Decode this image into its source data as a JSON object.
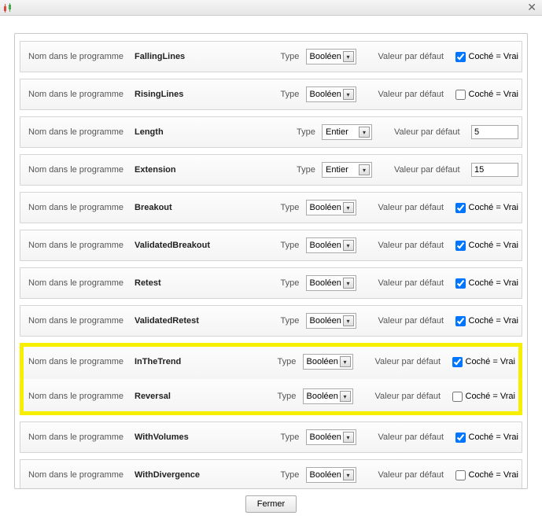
{
  "labels": {
    "name": "Nom dans le programme",
    "type": "Type",
    "default": "Valeur par défaut",
    "checked_true": "Coché = Vrai",
    "close_button": "Fermer"
  },
  "type_options": {
    "boolean": "Booléen",
    "integer": "Entier"
  },
  "rows": [
    {
      "name": "FallingLines",
      "type": "boolean",
      "checked": true
    },
    {
      "name": "RisingLines",
      "type": "boolean",
      "checked": false
    },
    {
      "name": "Length",
      "type": "integer",
      "value": "5"
    },
    {
      "name": "Extension",
      "type": "integer",
      "value": "15"
    },
    {
      "name": "Breakout",
      "type": "boolean",
      "checked": true
    },
    {
      "name": "ValidatedBreakout",
      "type": "boolean",
      "checked": true
    },
    {
      "name": "Retest",
      "type": "boolean",
      "checked": true
    },
    {
      "name": "ValidatedRetest",
      "type": "boolean",
      "checked": true
    },
    {
      "name": "InTheTrend",
      "type": "boolean",
      "checked": true,
      "highlight": "top"
    },
    {
      "name": "Reversal",
      "type": "boolean",
      "checked": false,
      "highlight": "bot"
    },
    {
      "name": "WithVolumes",
      "type": "boolean",
      "checked": true
    },
    {
      "name": "WithDivergence",
      "type": "boolean",
      "checked": false
    }
  ]
}
